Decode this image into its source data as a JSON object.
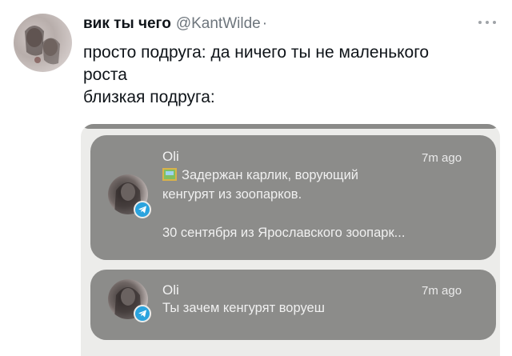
{
  "tweet": {
    "display_name": "вик ты чего",
    "handle": "@KantWilde",
    "separator": "·",
    "text_lines": [
      "просто подруга: да ничего ты не маленького",
      "роста",
      "близкая подруга:"
    ]
  },
  "notifications": [
    {
      "sender": "Oli",
      "time": "7m ago",
      "lines": [
        "Задержан карлик, ворующий",
        "кенгурят из зоопарков.",
        "30 сентября из Ярославского зоопарк..."
      ],
      "has_image_icon": true,
      "app_icon": "telegram-icon"
    },
    {
      "sender": "Oli",
      "time": "7m ago",
      "lines": [
        "Ты зачем кенгурят воруеш"
      ],
      "has_image_icon": false,
      "app_icon": "telegram-icon"
    }
  ],
  "colors": {
    "notification_bg": "#8c8c8a",
    "telegram": "#2aa3de",
    "handle_gray": "#6e767d"
  }
}
